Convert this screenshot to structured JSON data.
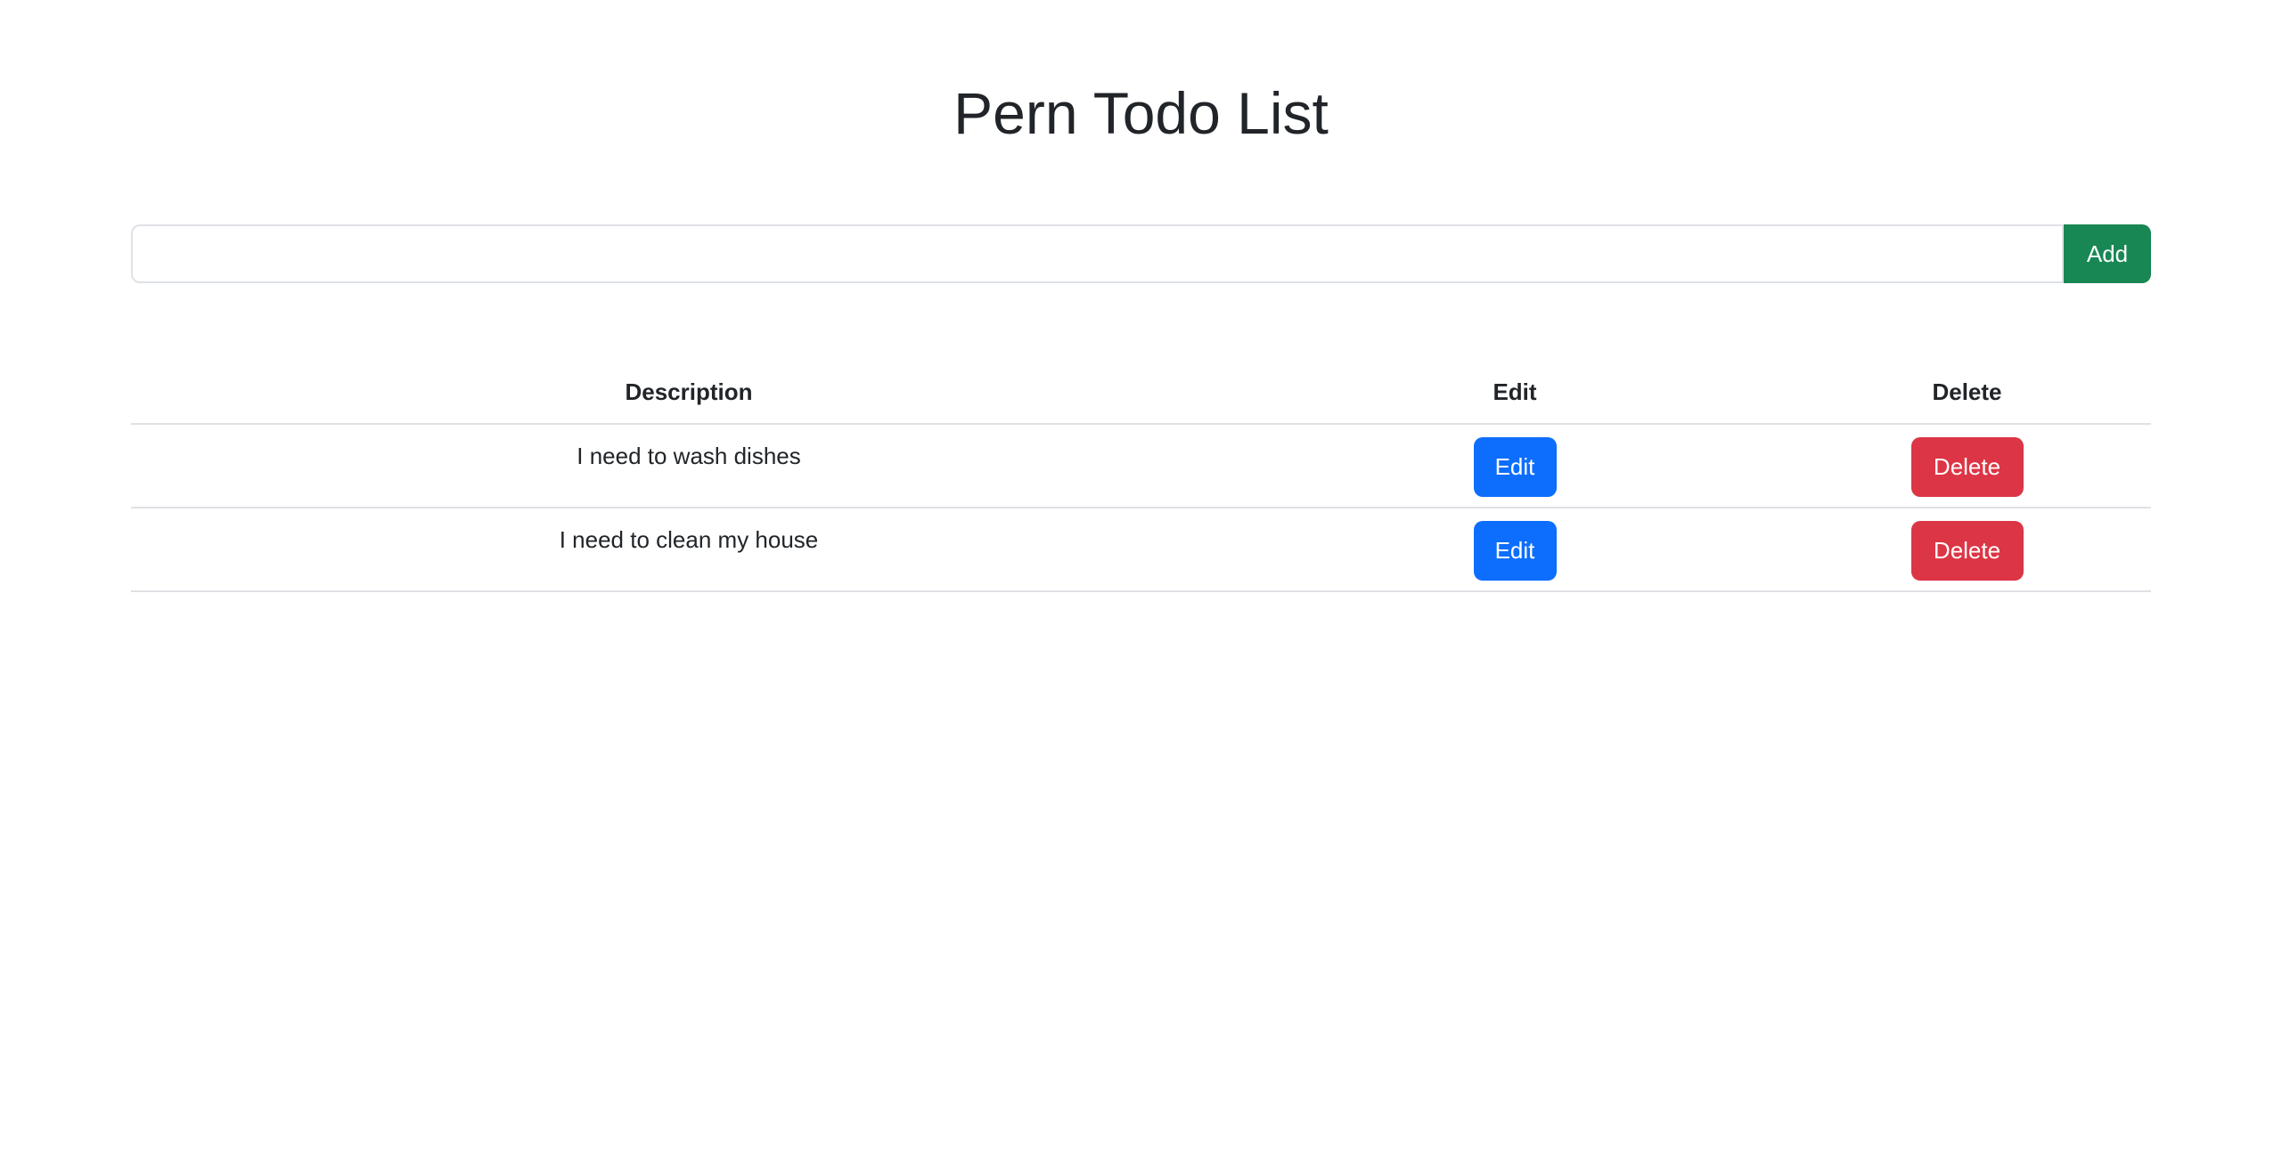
{
  "title": "Pern Todo List",
  "input": {
    "value": "",
    "add_label": "Add"
  },
  "table": {
    "headers": [
      "Description",
      "Edit",
      "Delete"
    ],
    "rows": [
      {
        "description": "I need to wash dishes",
        "edit_label": "Edit",
        "delete_label": "Delete"
      },
      {
        "description": "I need to clean my house",
        "edit_label": "Edit",
        "delete_label": "Delete"
      }
    ]
  },
  "colors": {
    "add": "#198754",
    "edit": "#0d6efd",
    "delete": "#dc3545"
  }
}
